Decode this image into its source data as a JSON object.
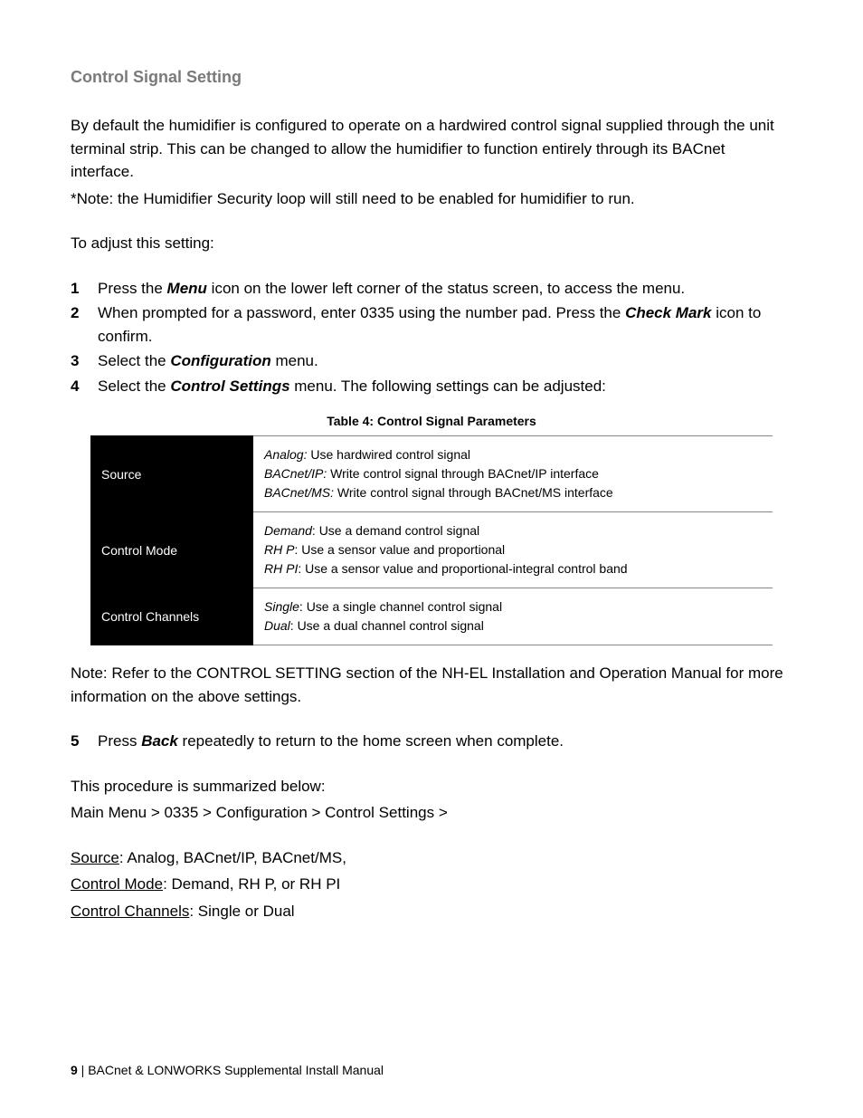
{
  "heading": "Control Signal Setting",
  "intro1": "By default the humidifier is configured to operate on a hardwired control signal supplied through the unit terminal strip.  This can be changed to allow the humidifier to function entirely through its BACnet interface.",
  "intro_note": "*Note: the Humidifier Security loop will still need to be enabled for humidifier to run.",
  "adjust_lead": "To adjust this setting:",
  "steps": {
    "s1a": "Press the ",
    "s1b": "Menu",
    "s1c": " icon on the lower left corner of the status screen, to access the menu.",
    "s2a": "When prompted for a password, enter 0335 using the number pad. Press the ",
    "s2b": "Check Mark",
    "s2c": " icon to confirm.",
    "s3a": "Select the ",
    "s3b": "Configuration",
    "s3c": " menu.",
    "s4a": "Select the ",
    "s4b": "Control Settings",
    "s4c": " menu.  The following settings can be adjusted:",
    "s5a": "Press ",
    "s5b": "Back",
    "s5c": " repeatedly to return to the home screen when complete."
  },
  "table_caption": "Table 4: Control Signal Parameters",
  "table": {
    "r1_label": "Source",
    "r1_l1_i": "Analog:",
    "r1_l1_t": "  Use hardwired control signal",
    "r1_l2_i": "BACnet/IP:",
    "r1_l2_t": " Write control signal through BACnet/IP interface",
    "r1_l3_i": "BACnet/MS:",
    "r1_l3_t": " Write control signal through BACnet/MS interface",
    "r2_label": "Control Mode",
    "r2_l1_i": "Demand",
    "r2_l1_t": ": Use a demand control signal",
    "r2_l2_i": "RH P",
    "r2_l2_t": ": Use a sensor value and proportional",
    "r2_l3_i": "RH PI",
    "r2_l3_t": ": Use a sensor value and proportional-integral control band",
    "r3_label": "Control Channels",
    "r3_l1_i": "Single",
    "r3_l1_t": ": Use a single channel control signal",
    "r3_l2_i": "Dual",
    "r3_l2_t": ": Use a dual channel control signal"
  },
  "note_ref": "Note: Refer to the CONTROL SETTING section of the NH-EL Installation and Operation Manual for more information on the above settings.",
  "summary_lead": "This procedure is summarized below:",
  "summary_path": "Main Menu > 0335 > Configuration > Control Settings >",
  "sum1_u": "Source",
  "sum1_t": ": Analog, BACnet/IP, BACnet/MS,",
  "sum2_u": "Control Mode",
  "sum2_t": ": Demand, RH P, or RH PI",
  "sum3_u": "Control Channels",
  "sum3_t": ": Single or Dual",
  "footer_page": "9",
  "footer_text": " | BACnet & LONWORKS Supplemental Install Manual"
}
